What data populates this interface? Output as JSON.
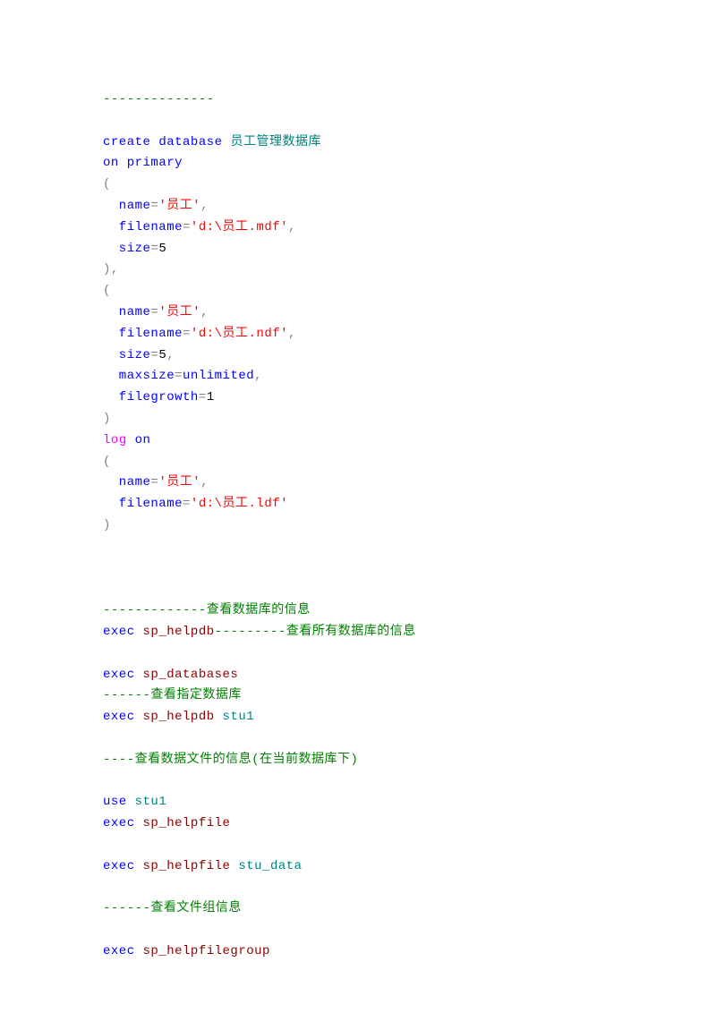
{
  "code": {
    "l1": "--------------",
    "l2_a": "create",
    "l2_b": " ",
    "l2_c": "database",
    "l2_d": " 员工管理数据库",
    "l3_a": "on",
    "l3_b": " ",
    "l3_c": "primary",
    "l4": "(",
    "l5_a": "  name",
    "l5_b": "=",
    "l5_c": "'员工'",
    "l5_d": ",",
    "l6_a": "  filename",
    "l6_b": "=",
    "l6_c": "'d:\\员工.mdf'",
    "l6_d": ",",
    "l7_a": "  size",
    "l7_b": "=",
    "l7_c": "5",
    "l8": "),",
    "l9": "(",
    "l10_a": "  name",
    "l10_b": "=",
    "l10_c": "'员工'",
    "l10_d": ",",
    "l11_a": "  filename",
    "l11_b": "=",
    "l11_c": "'d:\\员工.ndf'",
    "l11_d": ",",
    "l12_a": "  size",
    "l12_b": "=",
    "l12_c": "5",
    "l12_d": ",",
    "l13_a": "  maxsize",
    "l13_b": "=",
    "l13_c": "unlimited",
    "l13_d": ",",
    "l14_a": "  filegrowth",
    "l14_b": "=",
    "l14_c": "1",
    "l15": ")",
    "l16_a": "log",
    "l16_b": " ",
    "l16_c": "on",
    "l17": "(",
    "l18_a": "  name",
    "l18_b": "=",
    "l18_c": "'员工'",
    "l18_d": ",",
    "l19_a": "  filename",
    "l19_b": "=",
    "l19_c": "'d:\\员工.ldf'",
    "l20": ")",
    "l24": "-------------查看数据库的信息",
    "l25_a": "exec",
    "l25_b": " ",
    "l25_c": "sp_helpdb",
    "l25_d": "---------查看所有数据库的信息",
    "l27_a": "exec",
    "l27_b": " ",
    "l27_c": "sp_databases",
    "l28": "------查看指定数据库",
    "l29_a": "exec",
    "l29_b": " ",
    "l29_c": "sp_helpdb",
    "l29_d": " ",
    "l29_e": "stu1",
    "l31": "----查看数据文件的信息(在当前数据库下)",
    "l33_a": "use",
    "l33_b": " ",
    "l33_c": "stu1",
    "l34_a": "exec",
    "l34_b": " ",
    "l34_c": "sp_helpfile",
    "l36_a": "exec",
    "l36_b": " ",
    "l36_c": "sp_helpfile",
    "l36_d": " ",
    "l36_e": "stu_data",
    "l38": "------查看文件组信息",
    "l40_a": "exec",
    "l40_b": " ",
    "l40_c": "sp_helpfilegroup"
  }
}
